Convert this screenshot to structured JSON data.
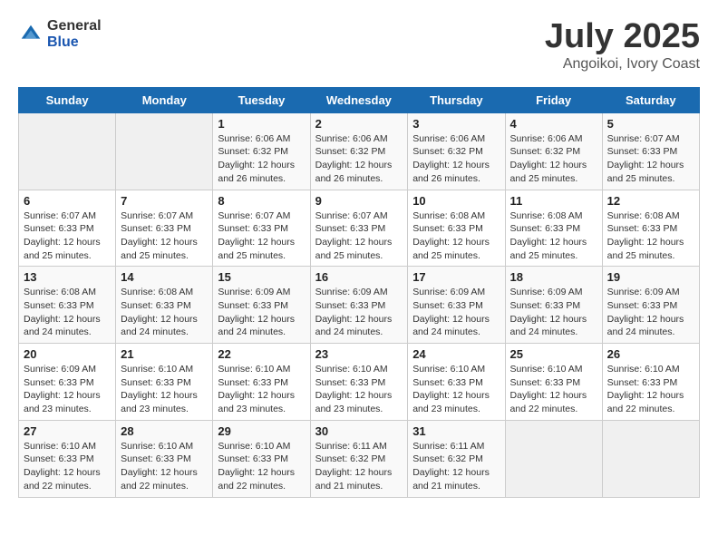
{
  "header": {
    "logo_general": "General",
    "logo_blue": "Blue",
    "title": "July 2025",
    "subtitle": "Angoikoi, Ivory Coast"
  },
  "weekdays": [
    "Sunday",
    "Monday",
    "Tuesday",
    "Wednesday",
    "Thursday",
    "Friday",
    "Saturday"
  ],
  "weeks": [
    [
      {
        "day": "",
        "info": ""
      },
      {
        "day": "",
        "info": ""
      },
      {
        "day": "1",
        "info": "Sunrise: 6:06 AM\nSunset: 6:32 PM\nDaylight: 12 hours and 26 minutes."
      },
      {
        "day": "2",
        "info": "Sunrise: 6:06 AM\nSunset: 6:32 PM\nDaylight: 12 hours and 26 minutes."
      },
      {
        "day": "3",
        "info": "Sunrise: 6:06 AM\nSunset: 6:32 PM\nDaylight: 12 hours and 26 minutes."
      },
      {
        "day": "4",
        "info": "Sunrise: 6:06 AM\nSunset: 6:32 PM\nDaylight: 12 hours and 25 minutes."
      },
      {
        "day": "5",
        "info": "Sunrise: 6:07 AM\nSunset: 6:33 PM\nDaylight: 12 hours and 25 minutes."
      }
    ],
    [
      {
        "day": "6",
        "info": "Sunrise: 6:07 AM\nSunset: 6:33 PM\nDaylight: 12 hours and 25 minutes."
      },
      {
        "day": "7",
        "info": "Sunrise: 6:07 AM\nSunset: 6:33 PM\nDaylight: 12 hours and 25 minutes."
      },
      {
        "day": "8",
        "info": "Sunrise: 6:07 AM\nSunset: 6:33 PM\nDaylight: 12 hours and 25 minutes."
      },
      {
        "day": "9",
        "info": "Sunrise: 6:07 AM\nSunset: 6:33 PM\nDaylight: 12 hours and 25 minutes."
      },
      {
        "day": "10",
        "info": "Sunrise: 6:08 AM\nSunset: 6:33 PM\nDaylight: 12 hours and 25 minutes."
      },
      {
        "day": "11",
        "info": "Sunrise: 6:08 AM\nSunset: 6:33 PM\nDaylight: 12 hours and 25 minutes."
      },
      {
        "day": "12",
        "info": "Sunrise: 6:08 AM\nSunset: 6:33 PM\nDaylight: 12 hours and 25 minutes."
      }
    ],
    [
      {
        "day": "13",
        "info": "Sunrise: 6:08 AM\nSunset: 6:33 PM\nDaylight: 12 hours and 24 minutes."
      },
      {
        "day": "14",
        "info": "Sunrise: 6:08 AM\nSunset: 6:33 PM\nDaylight: 12 hours and 24 minutes."
      },
      {
        "day": "15",
        "info": "Sunrise: 6:09 AM\nSunset: 6:33 PM\nDaylight: 12 hours and 24 minutes."
      },
      {
        "day": "16",
        "info": "Sunrise: 6:09 AM\nSunset: 6:33 PM\nDaylight: 12 hours and 24 minutes."
      },
      {
        "day": "17",
        "info": "Sunrise: 6:09 AM\nSunset: 6:33 PM\nDaylight: 12 hours and 24 minutes."
      },
      {
        "day": "18",
        "info": "Sunrise: 6:09 AM\nSunset: 6:33 PM\nDaylight: 12 hours and 24 minutes."
      },
      {
        "day": "19",
        "info": "Sunrise: 6:09 AM\nSunset: 6:33 PM\nDaylight: 12 hours and 24 minutes."
      }
    ],
    [
      {
        "day": "20",
        "info": "Sunrise: 6:09 AM\nSunset: 6:33 PM\nDaylight: 12 hours and 23 minutes."
      },
      {
        "day": "21",
        "info": "Sunrise: 6:10 AM\nSunset: 6:33 PM\nDaylight: 12 hours and 23 minutes."
      },
      {
        "day": "22",
        "info": "Sunrise: 6:10 AM\nSunset: 6:33 PM\nDaylight: 12 hours and 23 minutes."
      },
      {
        "day": "23",
        "info": "Sunrise: 6:10 AM\nSunset: 6:33 PM\nDaylight: 12 hours and 23 minutes."
      },
      {
        "day": "24",
        "info": "Sunrise: 6:10 AM\nSunset: 6:33 PM\nDaylight: 12 hours and 23 minutes."
      },
      {
        "day": "25",
        "info": "Sunrise: 6:10 AM\nSunset: 6:33 PM\nDaylight: 12 hours and 22 minutes."
      },
      {
        "day": "26",
        "info": "Sunrise: 6:10 AM\nSunset: 6:33 PM\nDaylight: 12 hours and 22 minutes."
      }
    ],
    [
      {
        "day": "27",
        "info": "Sunrise: 6:10 AM\nSunset: 6:33 PM\nDaylight: 12 hours and 22 minutes."
      },
      {
        "day": "28",
        "info": "Sunrise: 6:10 AM\nSunset: 6:33 PM\nDaylight: 12 hours and 22 minutes."
      },
      {
        "day": "29",
        "info": "Sunrise: 6:10 AM\nSunset: 6:33 PM\nDaylight: 12 hours and 22 minutes."
      },
      {
        "day": "30",
        "info": "Sunrise: 6:11 AM\nSunset: 6:32 PM\nDaylight: 12 hours and 21 minutes."
      },
      {
        "day": "31",
        "info": "Sunrise: 6:11 AM\nSunset: 6:32 PM\nDaylight: 12 hours and 21 minutes."
      },
      {
        "day": "",
        "info": ""
      },
      {
        "day": "",
        "info": ""
      }
    ]
  ]
}
